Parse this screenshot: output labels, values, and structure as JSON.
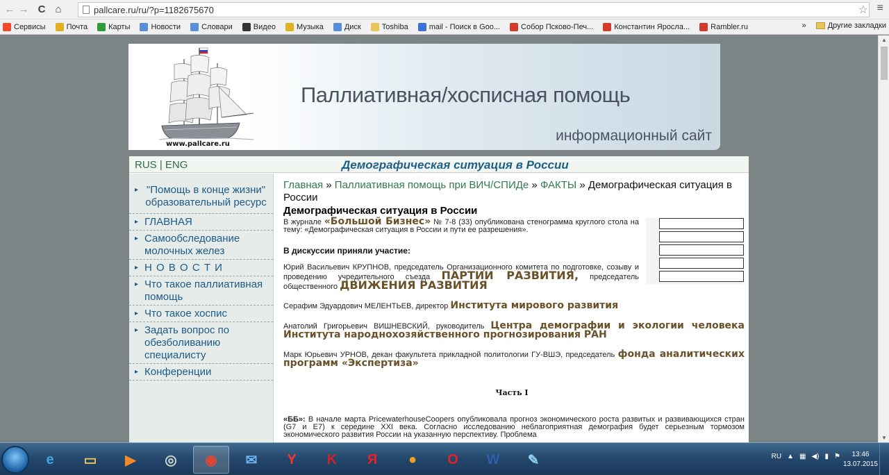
{
  "browser": {
    "url": "pallcare.ru/ru/?p=1182675670",
    "bookmarks": [
      {
        "label": "Сервисы",
        "color": "#f04a2a"
      },
      {
        "label": "Почта",
        "color": "#e0b020"
      },
      {
        "label": "Карты",
        "color": "#2f9c3a"
      },
      {
        "label": "Новости",
        "color": "#5a8ed8"
      },
      {
        "label": "Словари",
        "color": "#5a8ed8"
      },
      {
        "label": "Видео",
        "color": "#333333"
      },
      {
        "label": "Музыка",
        "color": "#e0b020"
      },
      {
        "label": "Диск",
        "color": "#5a8ed8"
      },
      {
        "label": "Toshiba",
        "color": "#e8c45a"
      },
      {
        "label": "mail - Поиск в Goo...",
        "color": "#3b6fd6"
      },
      {
        "label": "Собор Псково-Печ...",
        "color": "#d43a2a"
      },
      {
        "label": "Константин Яросла...",
        "color": "#d43a2a"
      },
      {
        "label": "Rambler.ru",
        "color": "#d43a2a"
      }
    ],
    "more_label": "»",
    "other_bookmarks": "Другие закладки"
  },
  "banner": {
    "title": "Паллиативная/хосписная помощь",
    "subtitle": "информационный сайт",
    "site_url": "www.pallcare.ru"
  },
  "topbar": {
    "lang_ru": "RUS",
    "sep": "|",
    "lang_en": "ENG",
    "heading": "Демографическая ситуация в России"
  },
  "sidebar": {
    "items": [
      "\"Помощь в конце жизни\" образовательный ресурс",
      "ГЛАВНАЯ",
      "Самообследование молочных желез",
      "Н О В О С Т И",
      "Что такое паллиативная помощь",
      "Что такое хоспис",
      "Задать вопрос по обезболиванию специалисту",
      "Конференции"
    ]
  },
  "breadcrumb": {
    "home": "Главная",
    "sep": "»",
    "section": "Паллиативная помощь при ВИЧ/СПИДе",
    "facts": "ФАКТЫ",
    "current": "Демографическая ситуация в России"
  },
  "article": {
    "title": "Демографическая ситуация в России",
    "intro_pre": "В журнале",
    "intro_mag": "«Большой Бизнес»",
    "intro_post": "№ 7-8 (33) опубликована стенограмма круглого стола на тему: «Демографическая ситуация в России и пути ее разрешения».",
    "discussion": "В дискуссии приняли участие:",
    "p1_text": "Юрий Васильевич КРУПНОВ, председатель Организационного комитета по подготовке, созыву и проведению учредительного съезда",
    "p1_org1": "ПАРТИИ РАЗВИТИЯ,",
    "p1_text2": "председатель общественного",
    "p1_org2": "ДВИЖЕНИЯ РАЗВИТИЯ",
    "p2_text": "Серафим Эдуардович МЕЛЕНТЬЕВ, директор",
    "p2_org": "Института мирового развития",
    "p3_text": "Анатолий Григорьевич ВИШНЕВСКИЙ, руководитель",
    "p3_org": "Центра демографии и экологии человека Института народнохозяйственного прогнозирования РАН",
    "p4_text": "Марк Юрьевич УРНОВ, декан факультета прикладной политологии ГУ-ВШЭ, председатель",
    "p4_org": "фонда аналитических программ «Экспертиза»",
    "part": "Часть I",
    "bb_label": "«ББ»:",
    "bb_text": "В начале марта PricewaterhouseCoopers опубликовала прогноз экономического роста развитых и развивающихся стран (G7 и E7) к середине XXI века. Согласно исследованию неблагоприятная демография будет серьезным тормозом экономического развития России на указанную перспективу. Проблема"
  },
  "taskbar": {
    "apps": [
      {
        "name": "ie",
        "glyph": "e",
        "color": "#3fa4e8"
      },
      {
        "name": "explorer",
        "glyph": "▭",
        "color": "#e8c45a"
      },
      {
        "name": "media",
        "glyph": "▶",
        "color": "#f08a2a"
      },
      {
        "name": "app-circle",
        "glyph": "◎",
        "color": "#d0d0d0"
      },
      {
        "name": "chrome",
        "glyph": "◉",
        "color": "#e8452f"
      },
      {
        "name": "mail",
        "glyph": "✉",
        "color": "#6fb4ef"
      },
      {
        "name": "yandex-browser",
        "glyph": "Y",
        "color": "#f03a2a"
      },
      {
        "name": "kaspersky",
        "glyph": "K",
        "color": "#d4202a"
      },
      {
        "name": "yandex",
        "glyph": "Я",
        "color": "#e8202a"
      },
      {
        "name": "aimp",
        "glyph": "●",
        "color": "#f0a020"
      },
      {
        "name": "opera",
        "glyph": "O",
        "color": "#e8202a"
      },
      {
        "name": "word",
        "glyph": "W",
        "color": "#2f5fae"
      },
      {
        "name": "paint",
        "glyph": "✎",
        "color": "#8fd0f0"
      }
    ],
    "lang": "RU",
    "time": "13:46",
    "date": "13.07.2015"
  }
}
